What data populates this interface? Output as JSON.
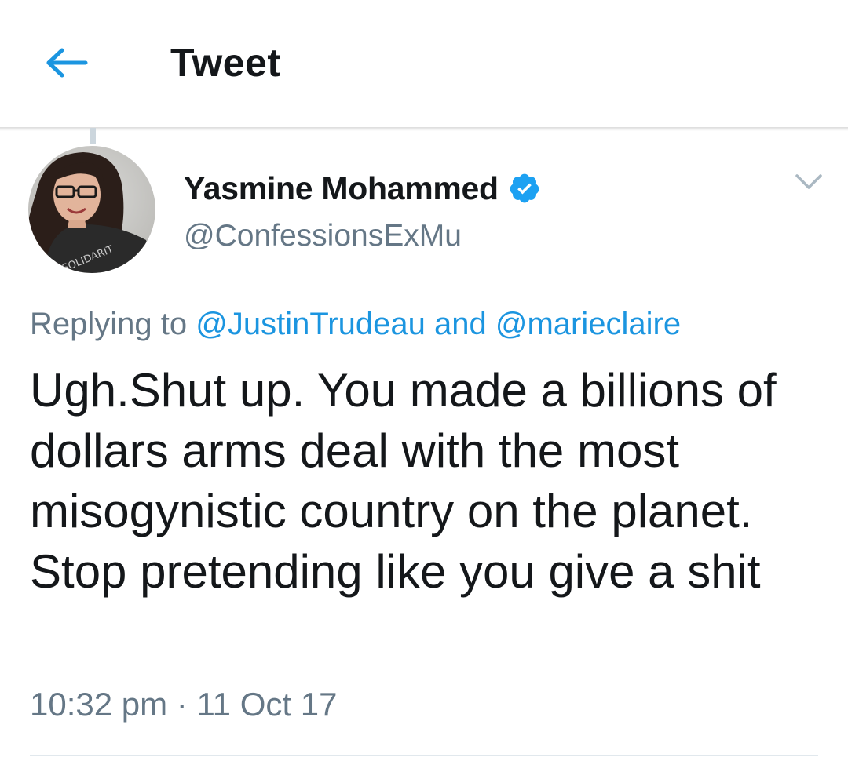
{
  "header": {
    "back_icon": "arrow-left-icon",
    "title": "Tweet"
  },
  "tweet": {
    "author": {
      "name": "Yasmine Mohammed",
      "handle": "@ConfessionsExMu",
      "verified": true,
      "verified_icon": "verified-badge-icon",
      "avatar_shirt_text": "SOLIDARIT"
    },
    "menu_icon": "chevron-down-icon",
    "reply_context": {
      "prefix": "Replying to",
      "mentions": [
        "@JustinTrudeau",
        "@marieclaire"
      ],
      "conjunction": "and"
    },
    "text": "Ugh.Shut up. You made a billions of dollars arms deal with the most misogynistic country on the planet. Stop pretending like you give a shit",
    "timestamp": "10:32 pm · 11 Oct 17"
  },
  "colors": {
    "accent": "#1b95e0",
    "text_primary": "#14171a",
    "text_secondary": "#657786",
    "divider": "#e1e8ed"
  }
}
